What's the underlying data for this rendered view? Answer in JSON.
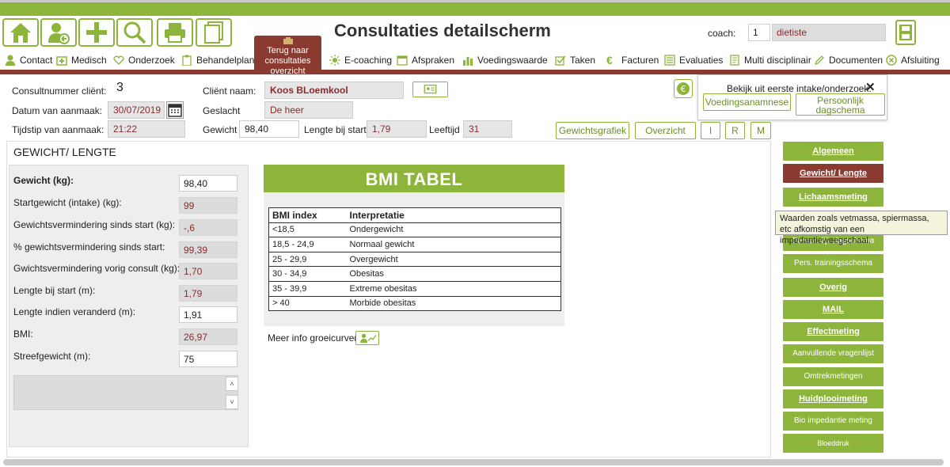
{
  "colors": {
    "accent": "#8db53c",
    "brand_dark": "#8b3a2f",
    "value_red": "#8b2a2a"
  },
  "toolbar": {
    "icons": [
      "home-icon",
      "user-back-icon",
      "plus-icon",
      "search-icon",
      "printer-icon",
      "documents-icon"
    ],
    "title": "Consultaties detailscherm",
    "coach_label": "coach:",
    "coach_number": "1",
    "coach_name": "dietiste",
    "back_label": "Terug naar consultaties overzicht"
  },
  "nav": [
    {
      "label": "Contact",
      "icon": "person-icon"
    },
    {
      "label": "Medisch",
      "icon": "medical-icon"
    },
    {
      "label": "Onderzoek",
      "icon": "heart-icon"
    },
    {
      "label": "Behandelplan",
      "icon": "clipboard-icon"
    },
    {
      "label": "E-coaching",
      "icon": "sun-icon"
    },
    {
      "label": "Afspraken",
      "icon": "calendar-icon"
    },
    {
      "label": "Voedingswaarde",
      "icon": "bars-icon"
    },
    {
      "label": "Taken",
      "icon": "check-icon"
    },
    {
      "label": "Facturen",
      "icon": "euro-icon"
    },
    {
      "label": "Evaluaties",
      "icon": "list-icon"
    },
    {
      "label": "Multi disciplinair",
      "icon": "document-icon"
    },
    {
      "label": "Documenten",
      "icon": "pencil-icon"
    },
    {
      "label": "Afsluiting",
      "icon": "close-circle-icon"
    }
  ],
  "form": {
    "consultnummer_label": "Consultnummer cliënt:",
    "consultnummer": "3",
    "datum_label": "Datum van aanmaak:",
    "datum": "30/07/2019",
    "tijdstip_label": "Tijdstip van aanmaak:",
    "tijdstip": "21:22",
    "client_naam_label": "Cliënt naam:",
    "client_naam": "Koos BLoemkool",
    "geslacht_label": "Geslacht",
    "geslacht": "De heer",
    "gewicht_label": "Gewicht",
    "gewicht": "98,40",
    "lengte_start_label": "Lengte bij start:",
    "lengte_start": "1,79",
    "leeftijd_label": "Leeftijd",
    "leeftijd": "31"
  },
  "buttons": {
    "gewichtsgrafiek": "Gewichtsgrafiek",
    "overzicht": "Overzicht",
    "i": "I",
    "r": "R",
    "m": "M"
  },
  "popup": {
    "title": "Bekijk uit eerste intake/onderzoek:",
    "close": "✕",
    "btn1": "Voedingsanamnese",
    "btn2": "Persoonlijk dagschema"
  },
  "section": {
    "title": "GEWICHT/ LENGTE",
    "rows": [
      {
        "label": "Gewicht (kg):",
        "value": "98,40",
        "editable": true,
        "bold": true
      },
      {
        "label": "Startgewicht (intake) (kg):",
        "value": "99",
        "editable": false
      },
      {
        "label": "Gewichtsvermindering sinds start (kg):",
        "value": "-,6",
        "editable": false
      },
      {
        "label": "% gewichtsvermindering sinds start:",
        "value": "99,39",
        "editable": false
      },
      {
        "label": "Gwichtsvermindering vorig consult (kg):",
        "value": "1,70",
        "editable": false
      },
      {
        "label": "Lengte bij start (m):",
        "value": "1,79",
        "editable": false
      },
      {
        "label": "Lengte indien veranderd (m):",
        "value": "1,91",
        "editable": true
      },
      {
        "label": "BMI:",
        "value": "26,97",
        "editable": false
      },
      {
        "label": "Streefgewicht (m):",
        "value": "75",
        "editable": true
      }
    ]
  },
  "bmi": {
    "title": "BMI TABEL",
    "headers": [
      "BMI index",
      "Interpretatie"
    ],
    "rows": [
      [
        "<18,5",
        "Ondergewicht"
      ],
      [
        "18,5 - 24,9",
        "Normaal gewicht"
      ],
      [
        "25 - 29,9",
        "Overgewicht"
      ],
      [
        "30 - 34,9",
        "Obesitas"
      ],
      [
        "35 - 39,9",
        "Extreme obesitas"
      ],
      [
        "> 40",
        "Morbide obesitas"
      ]
    ],
    "meer_info": "Meer info groeicurven"
  },
  "sidebar": [
    {
      "label": "Algemeen",
      "bold": true
    },
    {
      "label": "Gewicht/ Lengte",
      "bold": true,
      "active": true
    },
    {
      "label": "Lichaamsmeting",
      "bold": true
    },
    {
      "label": "Persoonlijk dagschema",
      "bold": false
    },
    {
      "label": "Pers. trainingsschema",
      "bold": false
    },
    {
      "label": "Overig",
      "bold": true
    },
    {
      "label": "MAIL",
      "bold": true
    },
    {
      "label": "Effectmeting",
      "bold": true
    },
    {
      "label": "Aanvullende vragenlijst",
      "bold": false
    },
    {
      "label": "Omtrekmetingen",
      "bold": false
    },
    {
      "label": "Huidplooimeting",
      "bold": true
    },
    {
      "label": "Bio impedantie meting",
      "bold": false
    },
    {
      "label": "Bloeddruk",
      "bold": false
    }
  ],
  "tooltip": "Waarden zoals vetmassa, spiermassa, etc afkomstig van een impedantieweegschaal."
}
